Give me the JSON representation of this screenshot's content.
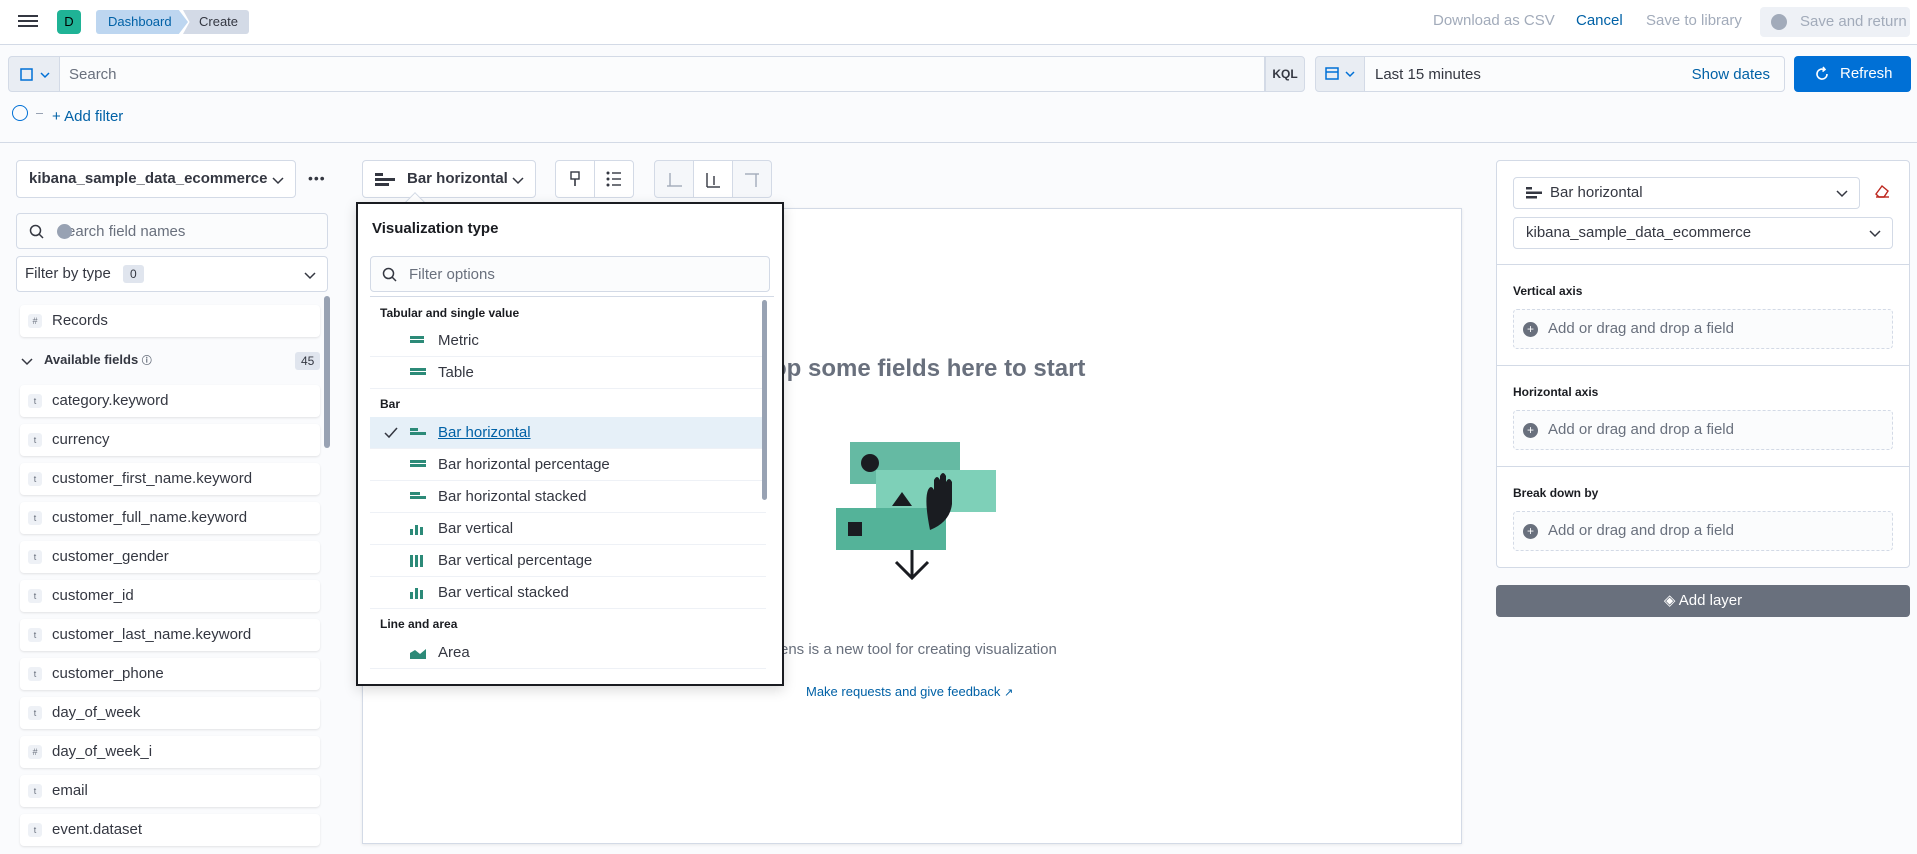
{
  "header": {
    "app_initial": "D",
    "breadcrumbs": [
      "Dashboard",
      "Create"
    ],
    "download_csv": "Download as CSV",
    "cancel": "Cancel",
    "save_to_library": "Save to library",
    "save_and_return": "Save and return"
  },
  "query_bar": {
    "search_placeholder": "Search",
    "language": "KQL",
    "time_range": "Last 15 minutes",
    "show_dates": "Show dates",
    "refresh": "Refresh",
    "add_filter": "+ Add filter"
  },
  "sidebar": {
    "index_pattern": "kibana_sample_data_ecommerce",
    "search_placeholder": "Search field names",
    "filter_by_type": "Filter by type",
    "filter_count": "0",
    "records": "Records",
    "available_fields_label": "Available fields",
    "available_fields_count": "45",
    "fields": [
      {
        "name": "category.keyword",
        "type": "t"
      },
      {
        "name": "currency",
        "type": "t"
      },
      {
        "name": "customer_first_name.keyword",
        "type": "t"
      },
      {
        "name": "customer_full_name.keyword",
        "type": "t"
      },
      {
        "name": "customer_gender",
        "type": "t"
      },
      {
        "name": "customer_id",
        "type": "t"
      },
      {
        "name": "customer_last_name.keyword",
        "type": "t"
      },
      {
        "name": "customer_phone",
        "type": "t"
      },
      {
        "name": "day_of_week",
        "type": "t"
      },
      {
        "name": "day_of_week_i",
        "type": "#"
      },
      {
        "name": "email",
        "type": "t"
      },
      {
        "name": "event.dataset",
        "type": "t"
      }
    ]
  },
  "toolbar": {
    "vis_type": "Bar horizontal"
  },
  "workspace": {
    "title": "op some fields here to start",
    "description": "ens is a new tool for creating visualization",
    "feedback_link": "Make requests and give feedback"
  },
  "vis_popover": {
    "title": "Visualization type",
    "filter_placeholder": "Filter options",
    "groups": {
      "tabular": "Tabular and single value",
      "bar": "Bar",
      "line": "Line and area"
    },
    "options": {
      "metric": "Metric",
      "table": "Table",
      "bar_h": "Bar horizontal",
      "bar_h_pct": "Bar horizontal percentage",
      "bar_h_stacked": "Bar horizontal stacked",
      "bar_v": "Bar vertical",
      "bar_v_pct": "Bar vertical percentage",
      "bar_v_stacked": "Bar vertical stacked",
      "area": "Area"
    },
    "selected": "Bar horizontal"
  },
  "config_panel": {
    "chart_type": "Bar horizontal",
    "index_pattern": "kibana_sample_data_ecommerce",
    "vertical_axis": "Vertical axis",
    "horizontal_axis": "Horizontal axis",
    "break_down_by": "Break down by",
    "dropzone_text": "Add or drag and drop a field",
    "add_layer": "Add layer"
  },
  "colors": {
    "primary": "#0070d6",
    "accent": "#1fb396",
    "link": "#0061a6"
  }
}
